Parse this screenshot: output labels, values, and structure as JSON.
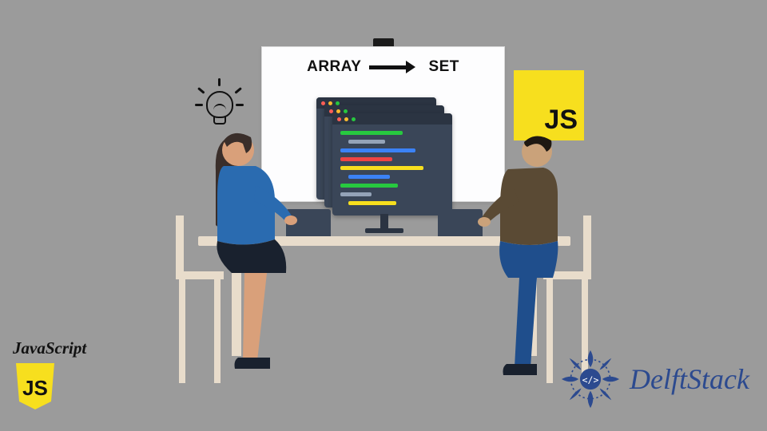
{
  "whiteboard": {
    "word_left": "ARRAY",
    "word_right": "SET"
  },
  "js_badge": {
    "label": "JS"
  },
  "bottom_left": {
    "language_label": "JavaScript",
    "shield_label": "JS"
  },
  "brand": {
    "name": "DelftStack"
  },
  "icons": {
    "lightbulb": "lightbulb-idea-icon",
    "arrow": "arrow-right-icon"
  },
  "colors": {
    "background": "#9b9b9b",
    "js_yellow": "#f7df1e",
    "delft_blue": "#2c4a8f",
    "desk": "#e8dccb",
    "code_window": "#3a4658"
  }
}
